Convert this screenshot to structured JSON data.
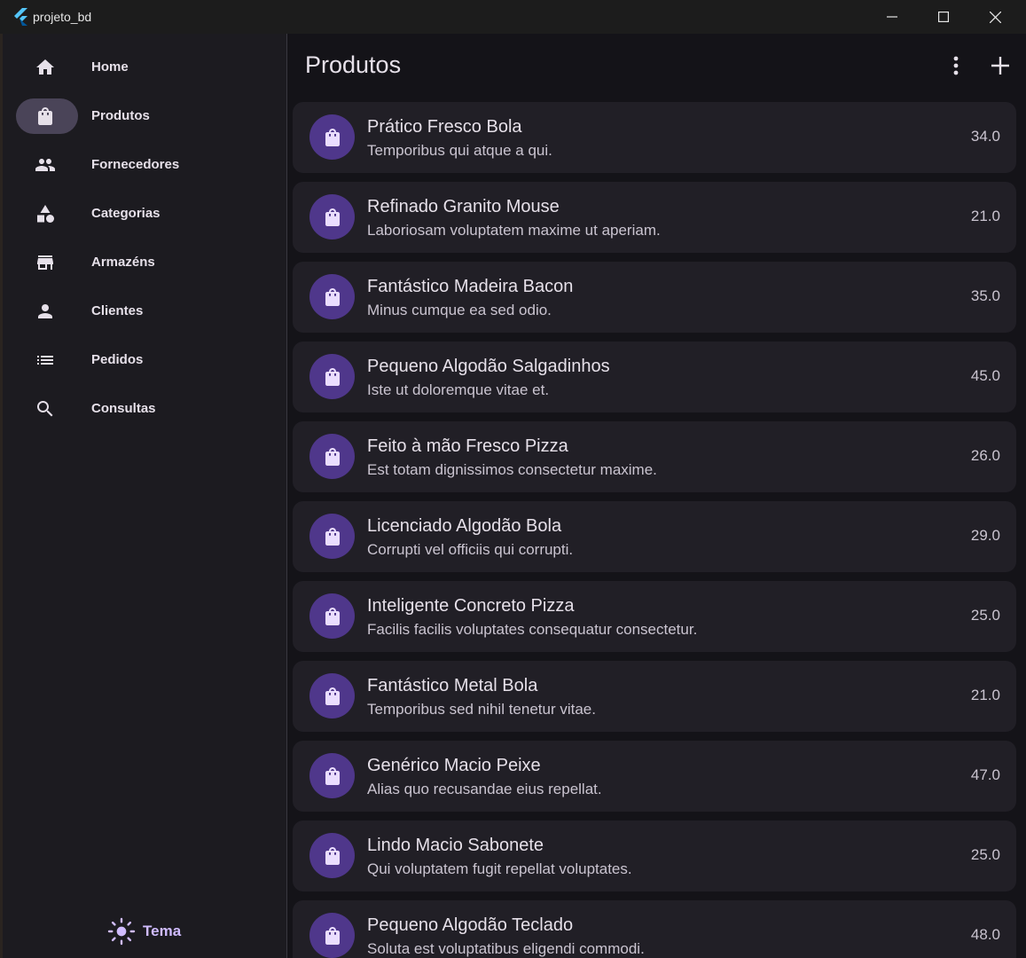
{
  "window": {
    "title": "projeto_bd"
  },
  "sidebar": {
    "items": [
      {
        "label": "Home",
        "icon": "home-icon",
        "active": false
      },
      {
        "label": "Produtos",
        "icon": "shopping-bag-icon",
        "active": true
      },
      {
        "label": "Fornecedores",
        "icon": "people-icon",
        "active": false
      },
      {
        "label": "Categorias",
        "icon": "category-icon",
        "active": false
      },
      {
        "label": "Armazéns",
        "icon": "store-icon",
        "active": false
      },
      {
        "label": "Clientes",
        "icon": "person-icon",
        "active": false
      },
      {
        "label": "Pedidos",
        "icon": "list-icon",
        "active": false
      },
      {
        "label": "Consultas",
        "icon": "search-icon",
        "active": false
      }
    ],
    "theme_label": "Tema"
  },
  "main": {
    "title": "Produtos",
    "products": [
      {
        "name": "Prático Fresco Bola",
        "description": "Temporibus qui atque a qui.",
        "price": "34.0"
      },
      {
        "name": "Refinado Granito Mouse",
        "description": "Laboriosam voluptatem maxime ut aperiam.",
        "price": "21.0"
      },
      {
        "name": "Fantástico Madeira Bacon",
        "description": "Minus cumque ea sed odio.",
        "price": "35.0"
      },
      {
        "name": "Pequeno Algodão Salgadinhos",
        "description": "Iste ut doloremque vitae et.",
        "price": "45.0"
      },
      {
        "name": "Feito à mão Fresco Pizza",
        "description": "Est totam dignissimos consectetur maxime.",
        "price": "26.0"
      },
      {
        "name": "Licenciado Algodão Bola",
        "description": "Corrupti vel officiis qui corrupti.",
        "price": "29.0"
      },
      {
        "name": "Inteligente Concreto Pizza",
        "description": "Facilis facilis voluptates consequatur consectetur.",
        "price": "25.0"
      },
      {
        "name": "Fantástico Metal Bola",
        "description": "Temporibus sed nihil tenetur vitae.",
        "price": "21.0"
      },
      {
        "name": "Genérico Macio Peixe",
        "description": "Alias quo recusandae eius repellat.",
        "price": "47.0"
      },
      {
        "name": "Lindo Macio Sabonete",
        "description": "Qui voluptatem fugit repellat voluptates.",
        "price": "25.0"
      },
      {
        "name": "Pequeno Algodão Teclado",
        "description": "Soluta est voluptatibus eligendi commodi.",
        "price": "48.0"
      }
    ]
  },
  "colors": {
    "accent": "#d0bcff",
    "avatar_bg": "#4f378b",
    "active_pill": "#4a4458",
    "card_bg": "#211f26"
  }
}
